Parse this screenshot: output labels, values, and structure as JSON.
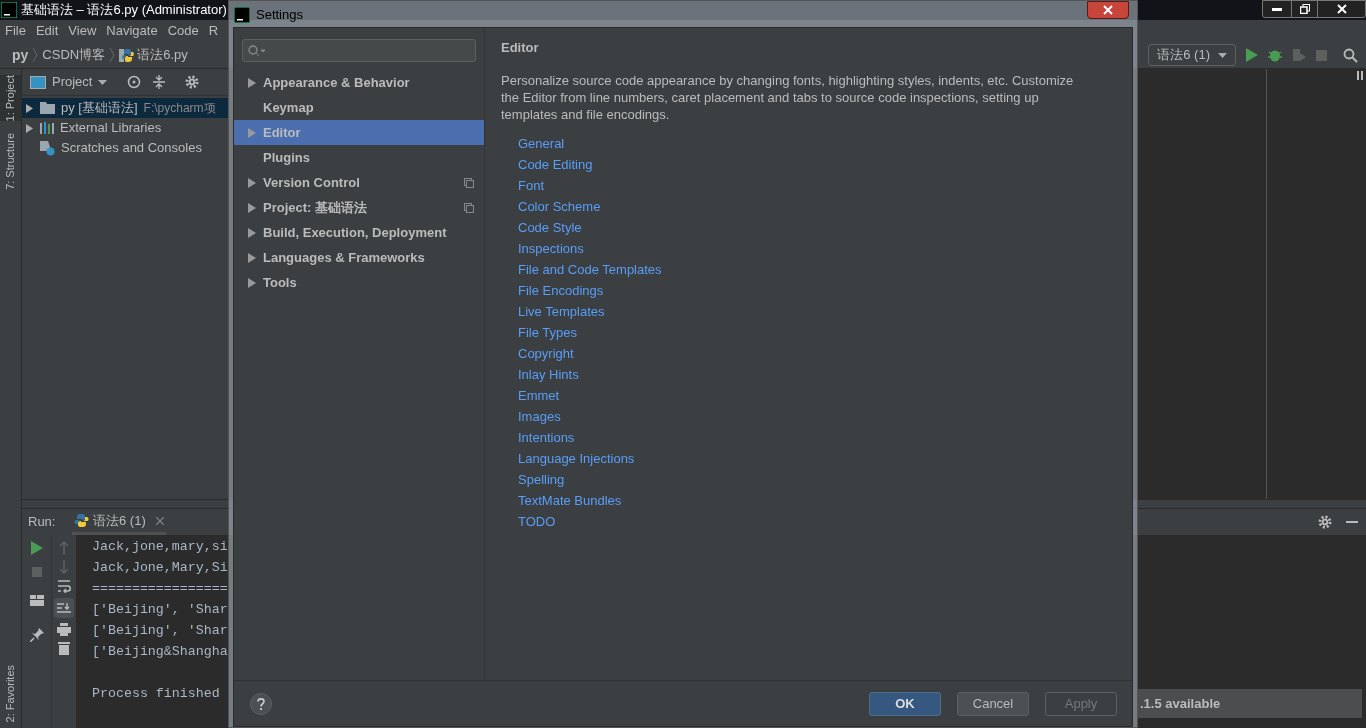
{
  "ide": {
    "title": "基础语法 – 语法6.py (Administrator)",
    "menu": [
      "File",
      "Edit",
      "View",
      "Navigate",
      "Code",
      "R"
    ],
    "breadcrumbs": [
      {
        "label": "py",
        "kind": "root"
      },
      {
        "label": "CSDN博客",
        "kind": "folder"
      },
      {
        "label": "语法6.py",
        "kind": "file"
      }
    ],
    "side_tabs": [
      {
        "label": "1: Project",
        "selected": true
      },
      {
        "label": "7: Structure",
        "selected": false
      },
      {
        "label": "2: Favorites",
        "selected": false
      }
    ],
    "project_panel": {
      "title": "Project",
      "tree": [
        {
          "label": "py [基础语法]",
          "path": "F:\\pycharm项",
          "kind": "folder",
          "expanded": false,
          "selected": true
        },
        {
          "label": "External Libraries",
          "kind": "library",
          "expanded": false,
          "selected": false
        },
        {
          "label": "Scratches and Consoles",
          "kind": "scratch",
          "selected": false
        }
      ]
    },
    "run_config": "语法6 (1)",
    "run_panel": {
      "label": "Run:",
      "tab": "语法6 (1)",
      "lines": [
        "Jack,jone,mary,si",
        "Jack,Jone,Mary,Si",
        "=================",
        "['Beijing', 'Shar",
        "['Beijing', 'Shar",
        "['Beijing&Shangha"
      ],
      "exit_message": "Process finished"
    },
    "notification": ".1.5 available"
  },
  "settings": {
    "title": "Settings",
    "nav": [
      {
        "label": "Appearance & Behavior",
        "has_children": true,
        "project_scoped": false,
        "selected": false
      },
      {
        "label": "Keymap",
        "has_children": false,
        "project_scoped": false,
        "selected": false
      },
      {
        "label": "Editor",
        "has_children": true,
        "project_scoped": false,
        "selected": true
      },
      {
        "label": "Plugins",
        "has_children": false,
        "project_scoped": false,
        "selected": false
      },
      {
        "label": "Version Control",
        "has_children": true,
        "project_scoped": true,
        "selected": false
      },
      {
        "label": "Project: 基础语法",
        "has_children": true,
        "project_scoped": true,
        "selected": false
      },
      {
        "label": "Build, Execution, Deployment",
        "has_children": true,
        "project_scoped": false,
        "selected": false
      },
      {
        "label": "Languages & Frameworks",
        "has_children": true,
        "project_scoped": false,
        "selected": false
      },
      {
        "label": "Tools",
        "has_children": true,
        "project_scoped": false,
        "selected": false
      }
    ],
    "heading": "Editor",
    "description": "Personalize source code appearance by changing fonts, highlighting styles, indents, etc. Customize the Editor from line numbers, caret placement and tabs to source code inspections, setting up templates and file encodings.",
    "links": [
      "General",
      "Code Editing",
      "Font",
      "Color Scheme",
      "Code Style",
      "Inspections",
      "File and Code Templates",
      "File Encodings",
      "Live Templates",
      "File Types",
      "Copyright",
      "Inlay Hints",
      "Emmet",
      "Images",
      "Intentions",
      "Language Injections",
      "Spelling",
      "TextMate Bundles",
      "TODO"
    ],
    "buttons": [
      {
        "label": "OK",
        "kind": "primary"
      },
      {
        "label": "Cancel",
        "kind": "normal"
      },
      {
        "label": "Apply",
        "kind": "disabled"
      }
    ]
  }
}
